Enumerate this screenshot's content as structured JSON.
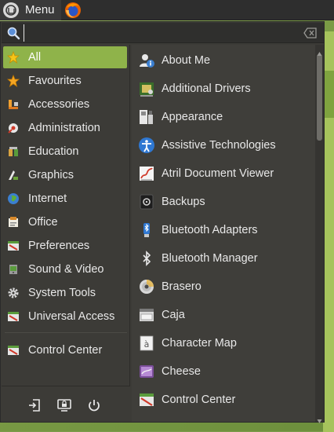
{
  "panel": {
    "menu_label": "Menu",
    "icons": [
      "mint-menu-icon",
      "firefox-icon"
    ]
  },
  "search": {
    "value": "",
    "placeholder": ""
  },
  "categories": [
    {
      "label": "All",
      "icon": "star-icon",
      "selected": true
    },
    {
      "label": "Favourites",
      "icon": "star-icon"
    },
    {
      "label": "Accessories",
      "icon": "accessories-icon"
    },
    {
      "label": "Administration",
      "icon": "administration-icon"
    },
    {
      "label": "Education",
      "icon": "education-icon"
    },
    {
      "label": "Graphics",
      "icon": "graphics-icon"
    },
    {
      "label": "Internet",
      "icon": "globe-icon"
    },
    {
      "label": "Office",
      "icon": "office-icon"
    },
    {
      "label": "Preferences",
      "icon": "preferences-icon"
    },
    {
      "label": "Sound & Video",
      "icon": "sound-video-icon"
    },
    {
      "label": "System Tools",
      "icon": "gear-icon"
    },
    {
      "label": "Universal Access",
      "icon": "universal-access-icon"
    }
  ],
  "control_center_category": {
    "label": "Control Center",
    "icon": "control-center-icon"
  },
  "bottom_actions": [
    {
      "name": "logout-icon"
    },
    {
      "name": "lock-screen-icon"
    },
    {
      "name": "power-icon"
    }
  ],
  "apps": [
    {
      "label": "About Me",
      "icon": "user-icon"
    },
    {
      "label": "Additional Drivers",
      "icon": "drivers-icon"
    },
    {
      "label": "Appearance",
      "icon": "appearance-icon"
    },
    {
      "label": "Assistive Technologies",
      "icon": "accessibility-icon"
    },
    {
      "label": "Atril Document Viewer",
      "icon": "document-viewer-icon"
    },
    {
      "label": "Backups",
      "icon": "backup-icon"
    },
    {
      "label": "Bluetooth Adapters",
      "icon": "bluetooth-adapter-icon"
    },
    {
      "label": "Bluetooth Manager",
      "icon": "bluetooth-icon"
    },
    {
      "label": "Brasero",
      "icon": "disc-icon"
    },
    {
      "label": "Caja",
      "icon": "file-manager-icon"
    },
    {
      "label": "Character Map",
      "icon": "character-map-icon"
    },
    {
      "label": "Cheese",
      "icon": "webcam-icon"
    },
    {
      "label": "Control Center",
      "icon": "control-center-icon"
    }
  ],
  "colors": {
    "accent": "#8fb34a",
    "panel_bg": "#2e2e2e",
    "menu_bg": "#3c3b37",
    "text": "#e8e8e8"
  }
}
